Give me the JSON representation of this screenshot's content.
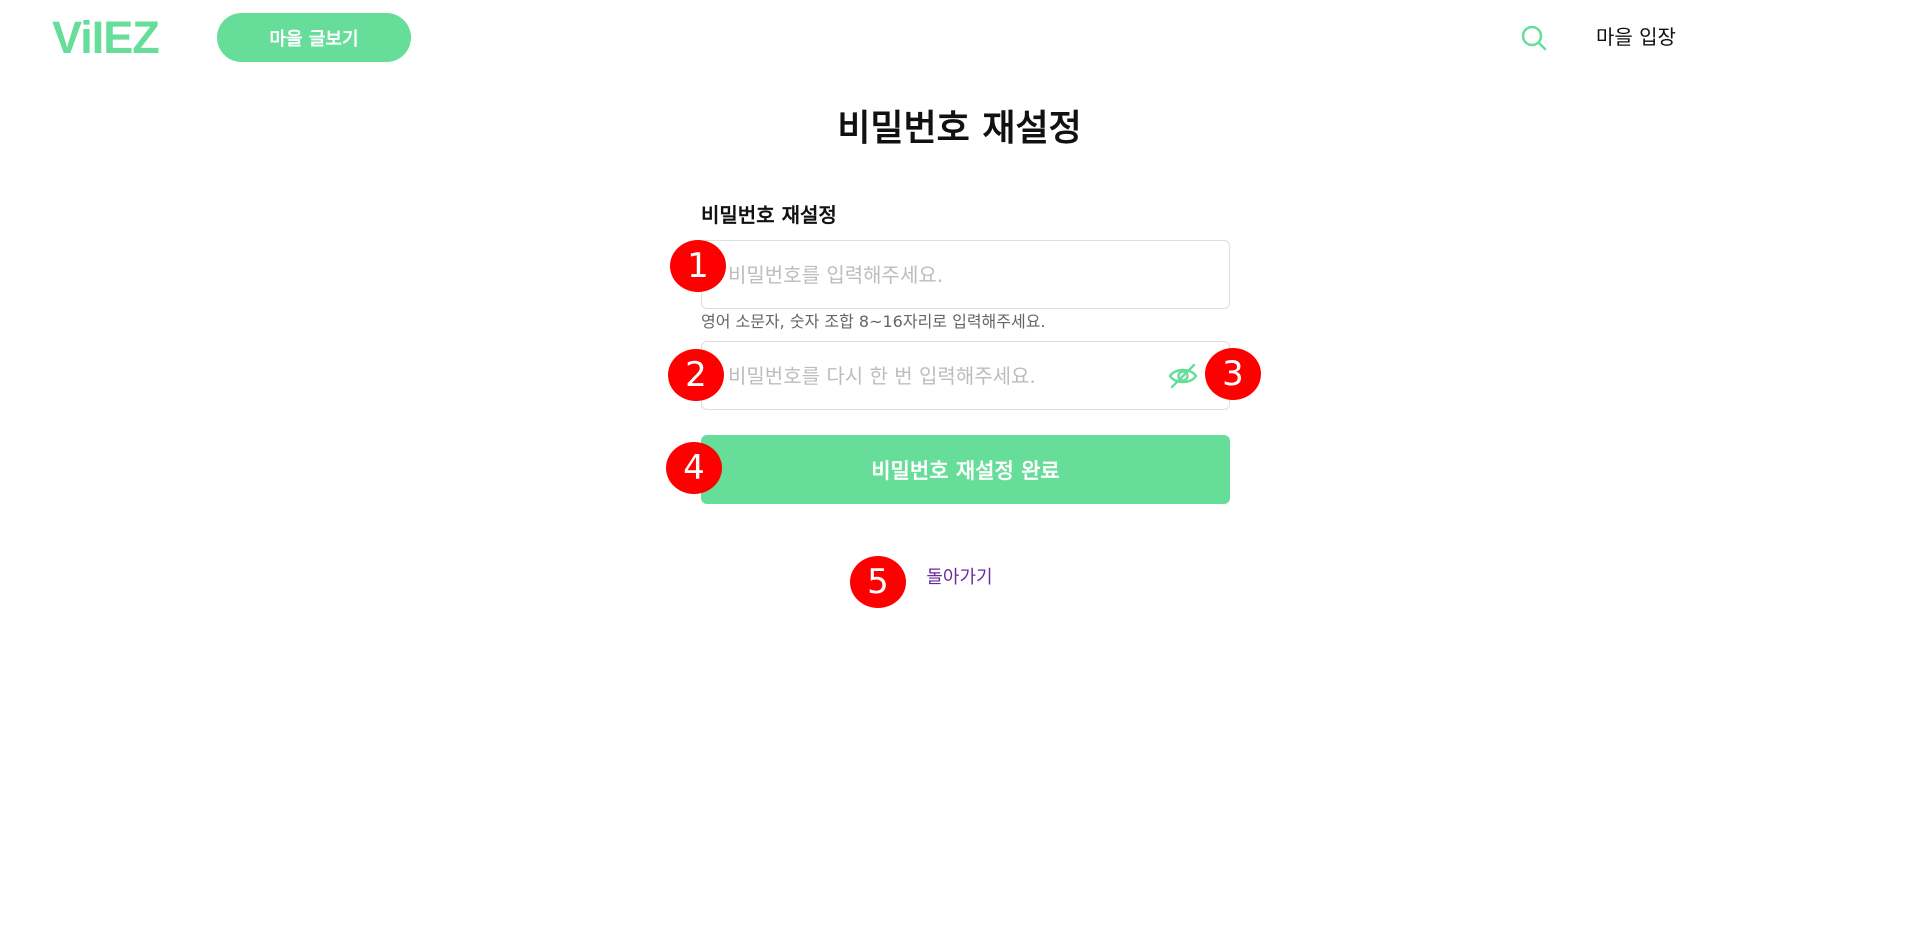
{
  "header": {
    "logo": "ViIEZ",
    "browse_button": "마을 글보기",
    "search_icon": "search-icon",
    "enter_label": "마을 입장"
  },
  "main": {
    "title": "비밀번호 재설정",
    "form_label": "비밀번호 재설정",
    "password": {
      "placeholder": "비밀번호를 입력해주세요.",
      "value": ""
    },
    "hint": "영어 소문자, 숫자 조합 8~16자리로 입력해주세요.",
    "confirm": {
      "placeholder": "비밀번호를 다시 한 번 입력해주세요.",
      "value": "",
      "toggle_icon": "eye-off-icon"
    },
    "submit_label": "비밀번호 재설정 완료",
    "back_label": "돌아가기"
  },
  "annotations": [
    "1",
    "2",
    "3",
    "4",
    "5"
  ],
  "colors": {
    "accent": "#66dd99",
    "marker": "#ff0000",
    "link": "#6a2aa0"
  }
}
